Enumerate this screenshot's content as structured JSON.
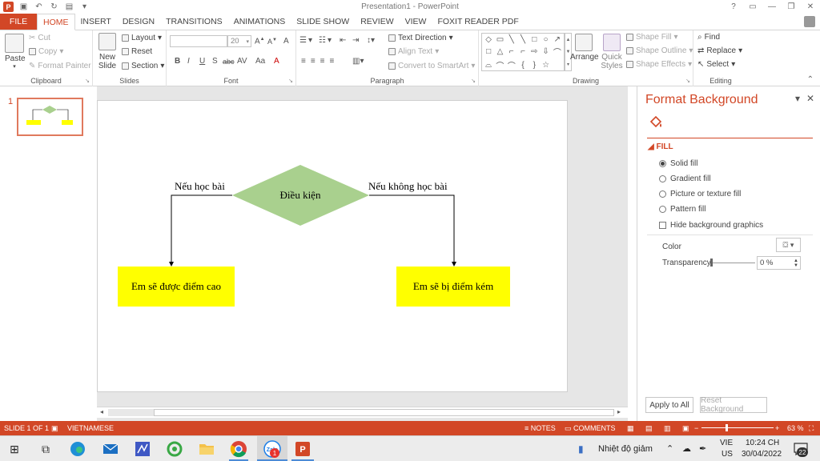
{
  "window": {
    "title": "Presentation1 - PowerPoint",
    "controls": [
      "?",
      "▭",
      "—",
      "❐",
      "✕"
    ]
  },
  "tabs": [
    "FILE",
    "HOME",
    "INSERT",
    "DESIGN",
    "TRANSITIONS",
    "ANIMATIONS",
    "SLIDE SHOW",
    "REVIEW",
    "VIEW",
    "FOXIT READER PDF"
  ],
  "ribbon": {
    "clipboard": {
      "label": "Clipboard",
      "paste": "Paste",
      "cut": "Cut",
      "copy": "Copy",
      "format_painter": "Format Painter"
    },
    "slides": {
      "label": "Slides",
      "new_slide_1": "New",
      "new_slide_2": "Slide",
      "layout": "Layout",
      "reset": "Reset",
      "section": "Section"
    },
    "font": {
      "label": "Font",
      "font_size": "20",
      "bold": "B",
      "italic": "I",
      "underline": "U",
      "shadow": "S",
      "strike": "abc",
      "spacing": "AV",
      "case": "Aa",
      "grow": "A",
      "shrink": "A",
      "clear": "A"
    },
    "paragraph": {
      "label": "Paragraph",
      "text_direction": "Text Direction",
      "align_text": "Align Text",
      "smartart": "Convert to SmartArt"
    },
    "drawing": {
      "label": "Drawing",
      "arrange": "Arrange",
      "quick_styles_1": "Quick",
      "quick_styles_2": "Styles",
      "shape_fill": "Shape Fill",
      "shape_outline": "Shape Outline",
      "shape_effects": "Shape Effects"
    },
    "editing": {
      "label": "Editing",
      "find": "Find",
      "replace": "Replace",
      "select": "Select"
    }
  },
  "thumbnails": {
    "slide_number": "1"
  },
  "slide": {
    "diamond_label": "Điều kiện",
    "left_branch": "Nếu học bài",
    "right_branch": "Nếu không học bài",
    "left_box": "Em sẽ được điểm cao",
    "right_box": "Em sẽ bị điểm kém",
    "diamond_color": "#a9d08e",
    "box_color": "#ffff00"
  },
  "format_pane": {
    "title": "Format Background",
    "section": "FILL",
    "options": [
      "Solid fill",
      "Gradient fill",
      "Picture or texture fill",
      "Pattern fill"
    ],
    "selected": "Solid fill",
    "hide_graphics": "Hide background graphics",
    "color_label": "Color",
    "transparency_label": "Transparency",
    "transparency_value": "0 %",
    "apply_all": "Apply to All",
    "reset_background": "Reset Background"
  },
  "statusbar": {
    "slide_info": "SLIDE 1 OF 1",
    "language": "VIETNAMESE",
    "notes": "NOTES",
    "comments": "COMMENTS",
    "zoom": "63 %",
    "accent": "#d24726"
  },
  "taskbar": {
    "weather": "Nhiệt độ giảm",
    "lang_1": "VIE",
    "lang_2": "US",
    "time": "10:24 CH",
    "date": "30/04/2022",
    "notifications": "22",
    "badge": "1"
  }
}
